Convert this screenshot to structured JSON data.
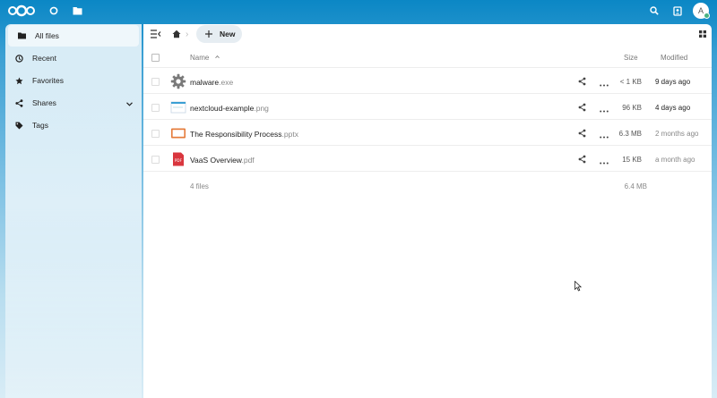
{
  "header": {
    "logo": "nextcloud-logo",
    "apps": [
      {
        "name": "dashboard",
        "icon": "circle-icon"
      },
      {
        "name": "files",
        "icon": "folder-icon"
      }
    ],
    "right_icons": [
      "search-icon",
      "contacts-icon"
    ],
    "avatar_letter": "A",
    "avatar_status_color": "#49b382",
    "brand_color": "#0082c9"
  },
  "sidebar": {
    "items": [
      {
        "label": "All files",
        "icon": "folder-icon",
        "active": true
      },
      {
        "label": "Recent",
        "icon": "clock-icon"
      },
      {
        "label": "Favorites",
        "icon": "star-icon"
      },
      {
        "label": "Shares",
        "icon": "share-icon",
        "expandable": true
      },
      {
        "label": "Tags",
        "icon": "tag-icon"
      }
    ]
  },
  "toolbar": {
    "new_label": "New"
  },
  "table": {
    "columns": {
      "name": "Name",
      "size": "Size",
      "modified": "Modified"
    },
    "rows": [
      {
        "base": "malware",
        "ext": ".exe",
        "icon": "gear-icon",
        "size": "< 1 KB",
        "modified": "9 days ago"
      },
      {
        "base": "nextcloud-example",
        "ext": ".png",
        "icon": "image-icon",
        "size": "96 KB",
        "modified": "4 days ago"
      },
      {
        "base": "The Responsibility Process",
        "ext": ".pptx",
        "icon": "presentation-icon",
        "size": "6.3 MB",
        "modified": "2 months ago"
      },
      {
        "base": "VaaS Overview",
        "ext": ".pdf",
        "icon": "pdf-icon",
        "size": "15 KB",
        "modified": "a month ago"
      }
    ],
    "summary": {
      "count": "4 files",
      "total_size": "6.4 MB"
    }
  }
}
